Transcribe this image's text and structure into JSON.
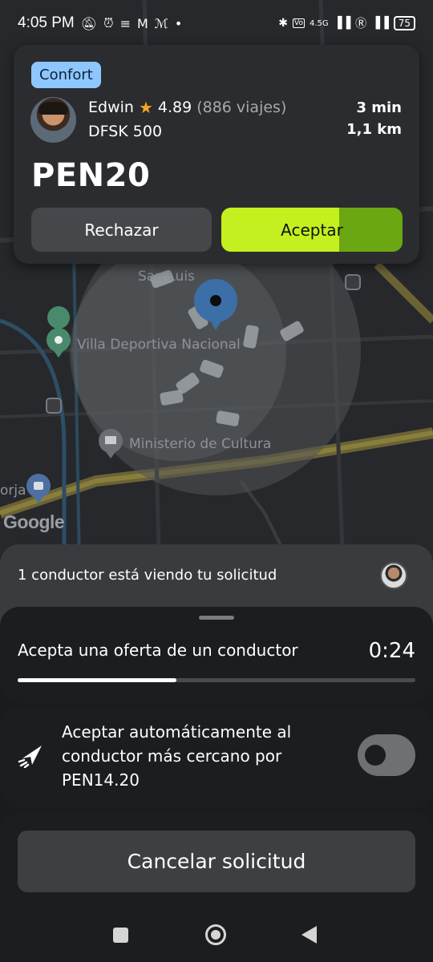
{
  "status_bar": {
    "time": "4:05 PM",
    "network_type": "4.5G",
    "battery": "75",
    "icons": [
      "mute-icon",
      "alarm-icon",
      "layers-icon",
      "gmail-icon",
      "movistar-icon",
      "dot-icon",
      "bluetooth-icon",
      "volte-icon",
      "signal-icon",
      "registered-icon",
      "wifi-signal-icon",
      "battery-icon"
    ]
  },
  "map": {
    "places": [
      "Villa Deportiva Nacional",
      "Ministerio de Cultura",
      "San Luis",
      "orja"
    ],
    "attribution": "Google"
  },
  "offer_card": {
    "category_badge": "Confort",
    "driver_name": "Edwin",
    "rating": "4.89",
    "trips": "(886 viajes)",
    "car_model": "DFSK 500",
    "eta": "3 min",
    "distance": "1,1 km",
    "price": "PEN20",
    "reject_label": "Rechazar",
    "accept_label": "Aceptar",
    "accept_color": "#c4f01f",
    "accept_countdown_color": "#6aa712",
    "badge_color": "#8ec7ff"
  },
  "viewers": {
    "text": "1 conductor está viendo tu solicitud"
  },
  "offer_wait": {
    "text": "Acepta una oferta de un conductor",
    "timer": "0:24",
    "progress": 0.4
  },
  "auto_accept": {
    "text": "Aceptar automáticamente al conductor más cercano por PEN14.20",
    "toggle_on": false
  },
  "cancel": {
    "label": "Cancelar solicitud"
  }
}
